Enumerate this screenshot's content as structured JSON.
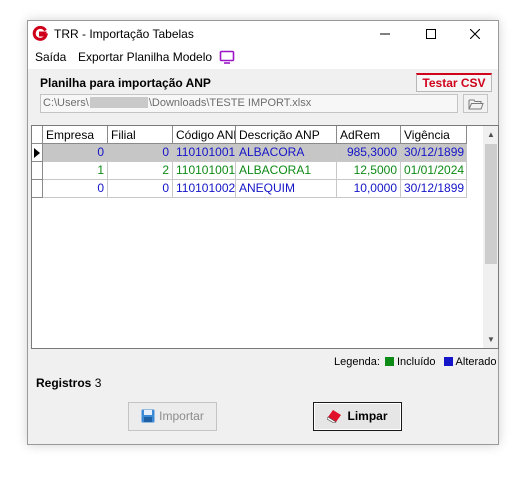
{
  "window": {
    "title": "TRR - Importação Tabelas",
    "controls": [
      "minimize",
      "maximize",
      "close"
    ]
  },
  "menu": {
    "items": [
      "Saída",
      "Exportar Planilha Modelo"
    ],
    "icon": "tv-icon"
  },
  "import_panel": {
    "label": "Planilha para importação ANP",
    "test_csv_label": "Testar CSV",
    "path_prefix": "C:\\Users\\",
    "path_suffix": "\\Downloads\\TESTE IMPORT.xlsx",
    "browse_icon": "folder-open-icon"
  },
  "table": {
    "columns": [
      "Empresa",
      "Filial",
      "Código ANP",
      "Descrição ANP",
      "AdRem",
      "Vigência"
    ],
    "rows": [
      {
        "empresa": "0",
        "filial": "0",
        "codigo": "110101001",
        "descricao": "ALBACORA",
        "adrem": "985,3000",
        "vigencia": "30/12/1899",
        "status": "alterado",
        "selected": true
      },
      {
        "empresa": "1",
        "filial": "2",
        "codigo": "110101001",
        "descricao": "ALBACORA1",
        "adrem": "12,5000",
        "vigencia": "01/01/2024",
        "status": "incluido",
        "selected": false
      },
      {
        "empresa": "0",
        "filial": "0",
        "codigo": "110101002",
        "descricao": "ANEQUIM",
        "adrem": "10,0000",
        "vigencia": "30/12/1899",
        "status": "alterado",
        "selected": false
      }
    ]
  },
  "legend": {
    "label": "Legenda:",
    "items": [
      {
        "name": "Incluído",
        "color": "#0e8a16"
      },
      {
        "name": "Alterado",
        "color": "#1414c8"
      }
    ]
  },
  "status": {
    "registros_label": "Registros",
    "registros_count": "3"
  },
  "actions": {
    "import_label": "Importar",
    "clear_label": "Limpar"
  },
  "colors": {
    "incluido": "#0e8a16",
    "alterado": "#1414c8",
    "accent": "#d0021b"
  }
}
